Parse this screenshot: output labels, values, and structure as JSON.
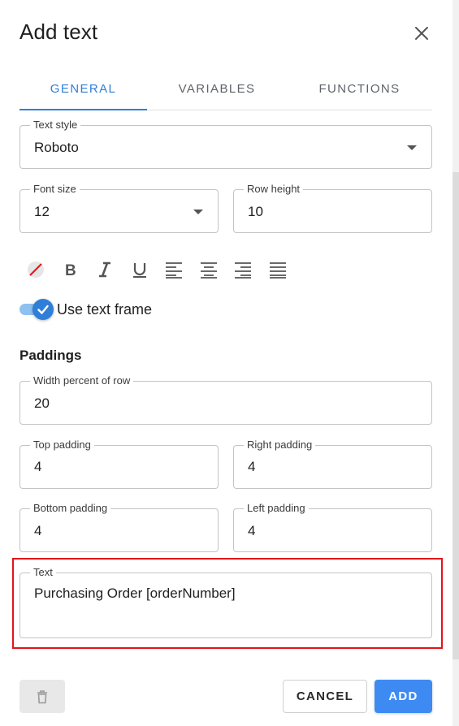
{
  "dialog": {
    "title": "Add text",
    "close_icon": "close-icon"
  },
  "tabs": [
    {
      "label": "GENERAL",
      "active": true
    },
    {
      "label": "VARIABLES",
      "active": false
    },
    {
      "label": "FUNCTIONS",
      "active": false
    }
  ],
  "text_style": {
    "label": "Text style",
    "value": "Roboto"
  },
  "font_size": {
    "label": "Font size",
    "value": "12"
  },
  "row_height": {
    "label": "Row height",
    "value": "10"
  },
  "toolbar": {
    "icons": [
      "no-color-icon",
      "bold-icon",
      "italic-icon",
      "underline-icon",
      "align-left-icon",
      "align-center-icon",
      "align-right-icon",
      "align-justify-icon"
    ]
  },
  "text_frame": {
    "label": "Use text frame",
    "checked": true
  },
  "paddings": {
    "title": "Paddings",
    "width_percent": {
      "label": "Width percent of row",
      "value": "20"
    },
    "top": {
      "label": "Top padding",
      "value": "4"
    },
    "right": {
      "label": "Right padding",
      "value": "4"
    },
    "bottom": {
      "label": "Bottom padding",
      "value": "4"
    },
    "left": {
      "label": "Left padding",
      "value": "4"
    }
  },
  "text_field": {
    "label": "Text",
    "value": "Purchasing Order [orderNumber]"
  },
  "actions": {
    "delete_icon": "delete-icon",
    "cancel_label": "CANCEL",
    "add_label": "ADD"
  },
  "colors": {
    "accent": "#2f7fd8",
    "add_button": "#3d8bf2",
    "highlight": "#e3141b"
  }
}
